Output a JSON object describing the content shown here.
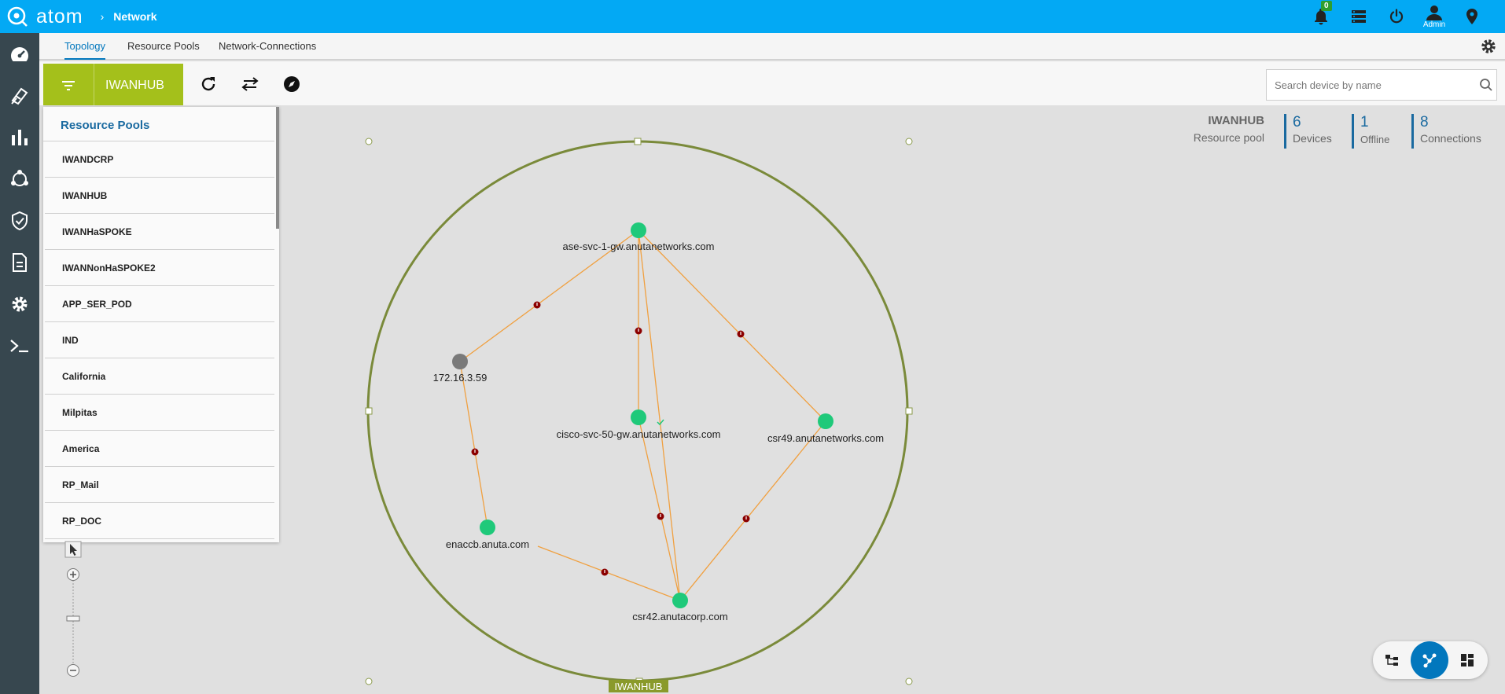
{
  "app": {
    "logo_text": "atom",
    "breadcrumb_separator": "›",
    "breadcrumb_current": "Network"
  },
  "header": {
    "notification_count": "0",
    "admin_label": "Admin"
  },
  "subnav": {
    "tabs": [
      {
        "label": "Topology",
        "active": true
      },
      {
        "label": "Resource Pools"
      },
      {
        "label": "Network-Connections"
      }
    ]
  },
  "toolbar": {
    "selected_pool": "IWANHUB",
    "search_placeholder": "Search device by name"
  },
  "resource_pools": {
    "title": "Resource Pools",
    "items": [
      "IWANDCRP",
      "IWANHUB",
      "IWANHaSPOKE",
      "IWANNonHaSPOKE2",
      "APP_SER_POD",
      "IND",
      "California",
      "Milpitas",
      "America",
      "RP_Mail",
      "RP_DOC"
    ]
  },
  "stats": {
    "pool_name": "IWANHUB",
    "pool_subtitle": "Resource pool",
    "devices_value": "6",
    "devices_label": "Devices",
    "offline_value": "1",
    "offline_label": "Offline",
    "connections_value": "8",
    "connections_label": "Connections"
  },
  "topology": {
    "group_label": "IWANHUB",
    "nodes": {
      "ase": {
        "label": "ase-svc-1-gw.anutanetworks.com",
        "status": "online"
      },
      "n172": {
        "label": "172.16.3.59",
        "status": "offline"
      },
      "cisco": {
        "label": "cisco-svc-50-gw.anutanetworks.com",
        "status": "online"
      },
      "csr49": {
        "label": "csr49.anutanetworks.com",
        "status": "online"
      },
      "enaccb": {
        "label": "enaccb.anuta.com",
        "status": "online"
      },
      "csr42": {
        "label": "csr42.anutacorp.com",
        "status": "online"
      }
    }
  },
  "colors": {
    "topbar": "#03a9f4",
    "sidebar": "#37474f",
    "pool_button": "#a4c01b",
    "accent": "#1a6aa0",
    "online_node": "#1fc97a",
    "offline_node": "#7a7a7a",
    "link": "#f0a040",
    "alarm": "#8b0000",
    "group_ring": "#7a8a3a"
  },
  "icons": {
    "sidebar": [
      "dashboard-icon",
      "devices-icon",
      "analytics-icon",
      "network-icon",
      "security-icon",
      "document-icon",
      "settings-icon",
      "terminal-icon"
    ]
  }
}
